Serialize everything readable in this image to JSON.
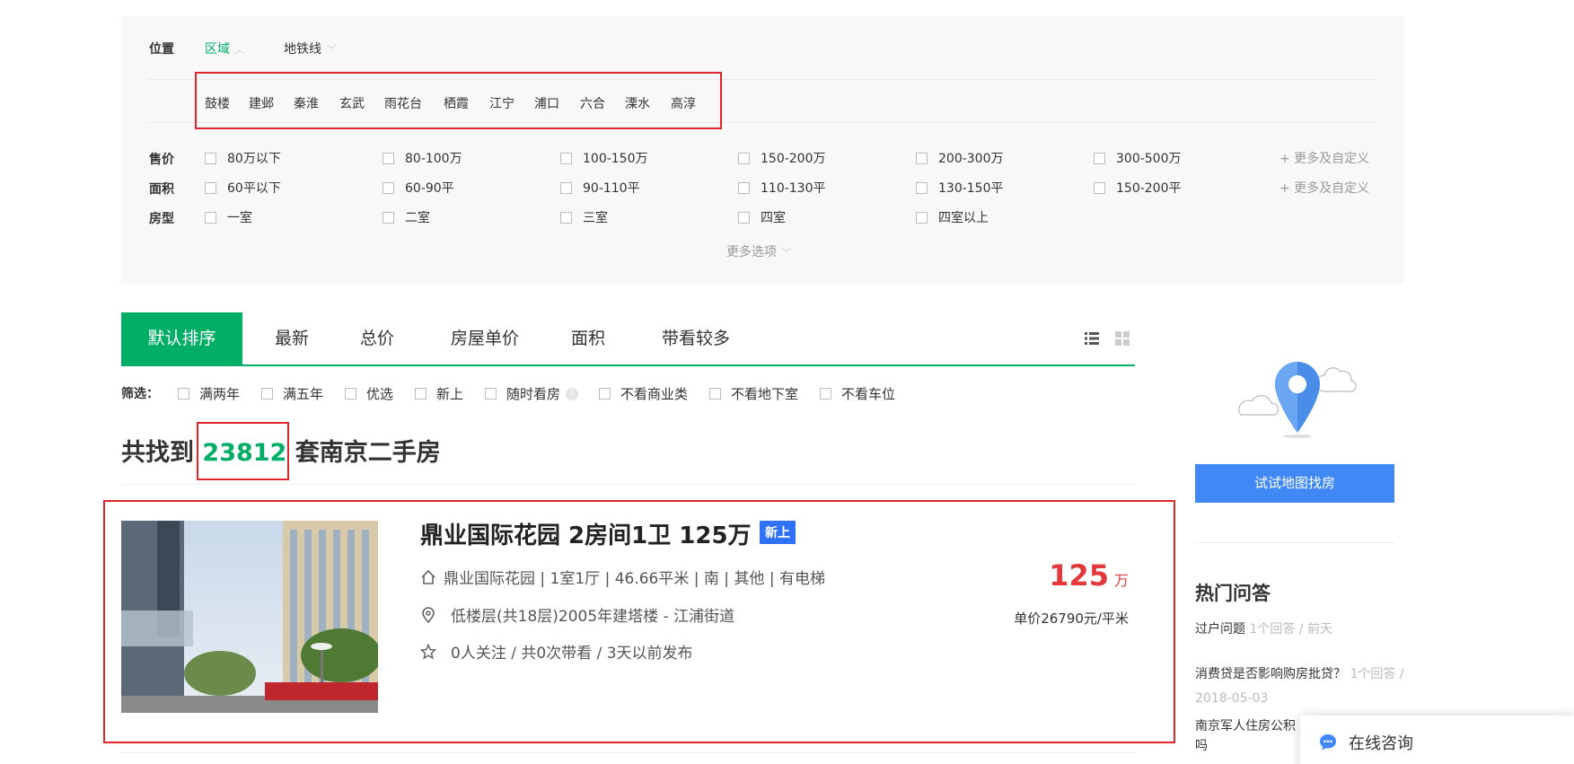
{
  "filters": {
    "location": {
      "label": "位置",
      "tabs": [
        {
          "label": "区域",
          "active": true
        },
        {
          "label": "地铁线",
          "active": false
        }
      ],
      "districts": [
        "鼓楼",
        "建邺",
        "秦淮",
        "玄武",
        "雨花台",
        "栖霞",
        "江宁",
        "浦口",
        "六合",
        "溧水",
        "高淳"
      ]
    },
    "price": {
      "label": "售价",
      "options": [
        "80万以下",
        "80-100万",
        "100-150万",
        "150-200万",
        "200-300万",
        "300-500万"
      ],
      "more": "+ 更多及自定义"
    },
    "area": {
      "label": "面积",
      "options": [
        "60平以下",
        "60-90平",
        "90-110平",
        "110-130平",
        "130-150平",
        "150-200平"
      ],
      "more": "+ 更多及自定义"
    },
    "rooms": {
      "label": "房型",
      "options": [
        "一室",
        "二室",
        "三室",
        "四室",
        "四室以上"
      ]
    },
    "more_options": "更多选项"
  },
  "sort": {
    "tabs": [
      "默认排序",
      "最新",
      "总价",
      "房屋单价",
      "面积",
      "带看较多"
    ],
    "active": 0
  },
  "quick_filters": {
    "label": "筛选：",
    "options": [
      "满两年",
      "满五年",
      "优选",
      "新上",
      "随时看房",
      "不看商业类",
      "不看地下室",
      "不看车位"
    ]
  },
  "result": {
    "prefix": "共找到",
    "count": "23812",
    "suffix": "套南京二手房"
  },
  "listing": {
    "title": "鼎业国际花园 2房间1卫 125万",
    "badge": "新上",
    "house_info": "鼎业国际花园 | 1室1厅 | 46.66平米 | 南 | 其他 | 有电梯",
    "position_info": "低楼层(共18层)2005年建塔楼 - 江浦街道",
    "follow_info": "0人关注 / 共0次带看 / 3天以前发布",
    "total_price": "125",
    "price_unit": "万",
    "unit_price": "单价26790元/平米"
  },
  "sidebar": {
    "map_button": "试试地图找房",
    "qa_title": "热门问答",
    "qa_items": [
      {
        "question": "过户问题",
        "meta": "1个回答 / 前天"
      },
      {
        "question": "消费贷是否影响购房批贷？",
        "meta": "1个回答 / 2018-05-03"
      },
      {
        "question": "南京军人住房公积",
        "meta": ""
      },
      {
        "question": "吗",
        "meta": ""
      }
    ]
  },
  "consult": {
    "label": "在线咨询"
  },
  "colors": {
    "accent": "#00ae66",
    "price": "#e4393c",
    "badge": "#3072f6",
    "map_button": "#3f88f5",
    "highlight": "#e0262c"
  }
}
